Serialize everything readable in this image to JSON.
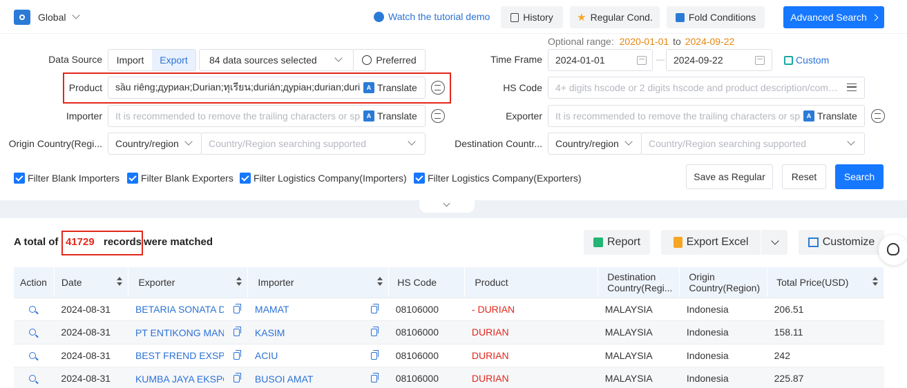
{
  "topbar": {
    "scope": "Global",
    "tutorial": "Watch the tutorial demo",
    "history": "History",
    "regular_cond": "Regular Cond.",
    "fold_conditions": "Fold Conditions",
    "advanced_search": "Advanced Search"
  },
  "form": {
    "optional_range_label": "Optional range:",
    "optional_range_start": "2020-01-01",
    "optional_range_to": "to",
    "optional_range_end": "2024-09-22",
    "data_source_label": "Data Source",
    "import_tab": "Import",
    "export_tab": "Export",
    "sources_selected": "84 data sources selected",
    "preferred": "Preferred",
    "time_frame_label": "Time Frame",
    "date_from": "2024-01-01",
    "date_sep": "—",
    "date_to": "2024-09-22",
    "custom": "Custom",
    "product_label": "Product",
    "product_value": "sầu riêng;дуриан;Durian;ทุเรียน;durián;дуріан;durian;durian",
    "translate": "Translate",
    "hs_code_label": "HS Code",
    "hs_code_placeholder": "4+ digits hscode or 2 digits hscode and product description/comp...",
    "importer_label": "Importer",
    "importer_placeholder": "It is recommended to remove the trailing characters or spe",
    "exporter_label": "Exporter",
    "exporter_placeholder": "It is recommended to remove the trailing characters or spe",
    "origin_label": "Origin Country(Regi...",
    "destination_label": "Destination Countr...",
    "country_region": "Country/region",
    "country_placeholder": "Country/Region searching supported",
    "filters": [
      "Filter Blank Importers",
      "Filter Blank Exporters",
      "Filter Logistics Company(Importers)",
      "Filter Logistics Company(Exporters)"
    ],
    "save_regular": "Save as Regular",
    "reset": "Reset",
    "search": "Search"
  },
  "results": {
    "prefix": "A total of",
    "count": "41729",
    "records": "records",
    "suffix": "were matched",
    "report": "Report",
    "export_excel": "Export Excel",
    "customize": "Customize"
  },
  "table": {
    "columns": [
      "Action",
      "Date",
      "Exporter",
      "Importer",
      "HS Code",
      "Product",
      "Destination Country(Regi...",
      "Origin Country(Region)",
      "Total Price(USD)"
    ],
    "rows": [
      {
        "date": "2024-08-31",
        "exporter": "BETARIA SONATA DE",
        "importer": "MAMAT",
        "hs": "08106000",
        "product": "- DURIAN",
        "dest": "MALAYSIA",
        "origin": "Indonesia",
        "price": "206.51"
      },
      {
        "date": "2024-08-31",
        "exporter": "PT ENTIKONG MAND",
        "importer": "KASIM",
        "hs": "08106000",
        "product": "DURIAN",
        "dest": "MALAYSIA",
        "origin": "Indonesia",
        "price": "158.11"
      },
      {
        "date": "2024-08-31",
        "exporter": "BEST FREND EXSPO",
        "importer": "ACIU",
        "hs": "08106000",
        "product": "DURIAN",
        "dest": "MALAYSIA",
        "origin": "Indonesia",
        "price": "242"
      },
      {
        "date": "2024-08-31",
        "exporter": "KUMBA JAYA EKSPO",
        "importer": "BUSOI AMAT",
        "hs": "08106000",
        "product": "DURIAN",
        "dest": "MALAYSIA",
        "origin": "Indonesia",
        "price": "225.87"
      }
    ]
  },
  "colors": {
    "accent": "#1677ff",
    "highlight": "#e3261b",
    "orange": "#e6850e"
  }
}
